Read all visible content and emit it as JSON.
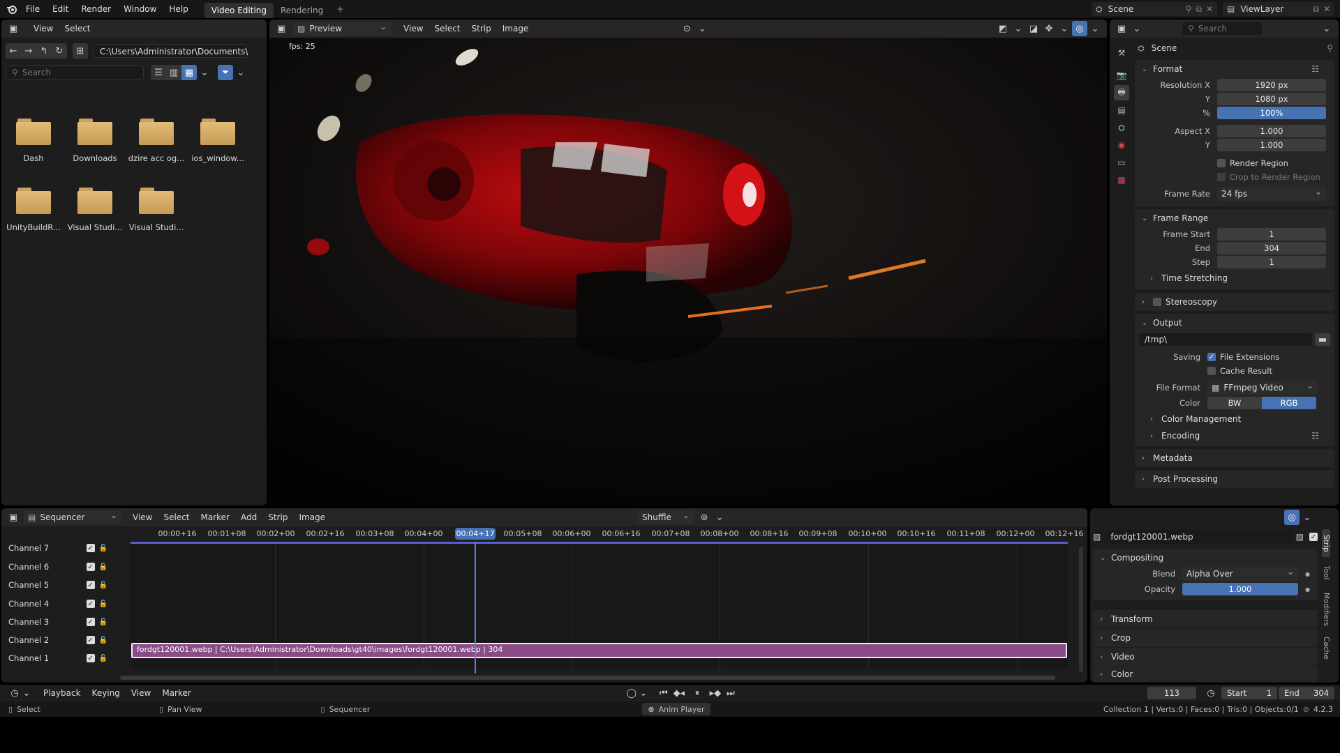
{
  "menu": {
    "items": [
      "File",
      "Edit",
      "Render",
      "Window",
      "Help"
    ],
    "workspaces": [
      "Video Editing",
      "Rendering"
    ],
    "add_tab": "+",
    "scene_name": "Scene",
    "view_layer": "ViewLayer"
  },
  "file_browser": {
    "menu": [
      "View",
      "Select"
    ],
    "path": "C:\\Users\\Administrator\\Documents\\",
    "search_placeholder": "Search",
    "items": [
      "Dash",
      "Downloads",
      "dzire acc og...",
      "ios_window...",
      "UnityBuildR...",
      "Visual Studi...",
      "Visual Studi..."
    ]
  },
  "preview": {
    "mode": "Preview",
    "menu": [
      "View",
      "Select",
      "Strip",
      "Image"
    ],
    "fps_text": "fps: 25"
  },
  "properties": {
    "search_placeholder": "Search",
    "context": "Scene",
    "format": {
      "title": "Format",
      "resolution_x_label": "Resolution X",
      "resolution_x": "1920 px",
      "y_label": "Y",
      "resolution_y": "1080 px",
      "pct_label": "%",
      "resolution_pct": "100%",
      "aspect_x_label": "Aspect X",
      "aspect_x": "1.000",
      "aspect_y_label": "Y",
      "aspect_y": "1.000",
      "render_region": "Render Region",
      "crop_region": "Crop to Render Region",
      "frame_rate_label": "Frame Rate",
      "frame_rate": "24 fps"
    },
    "frame_range": {
      "title": "Frame Range",
      "start_label": "Frame Start",
      "start": "1",
      "end_label": "End",
      "end": "304",
      "step_label": "Step",
      "step": "1",
      "time_stretching": "Time Stretching"
    },
    "stereoscopy": "Stereoscopy",
    "output": {
      "title": "Output",
      "path": "/tmp\\",
      "saving_label": "Saving",
      "file_extensions": "File Extensions",
      "cache_result": "Cache Result",
      "file_format_label": "File Format",
      "file_format": "FFmpeg Video",
      "color_label": "Color",
      "color_bw": "BW",
      "color_rgb": "RGB",
      "color_management": "Color Management",
      "encoding": "Encoding"
    },
    "metadata": "Metadata",
    "post_processing": "Post Processing"
  },
  "sequencer": {
    "editor": "Sequencer",
    "menu": [
      "View",
      "Select",
      "Marker",
      "Add",
      "Strip",
      "Image"
    ],
    "snap_mode": "Shuffle",
    "timecodes": [
      "00:00+16",
      "00:01+08",
      "00:02+00",
      "00:02+16",
      "00:03+08",
      "00:04+00",
      "00:04+17",
      "00:05+08",
      "00:06+00",
      "00:06+16",
      "00:07+08",
      "00:08+00",
      "00:08+16",
      "00:09+08",
      "00:10+00",
      "00:10+16",
      "00:11+08",
      "00:12+00",
      "00:12+16"
    ],
    "current_timecode": "00:04+17",
    "channels": [
      "Channel 7",
      "Channel 6",
      "Channel 5",
      "Channel 4",
      "Channel 3",
      "Channel 2",
      "Channel 1"
    ],
    "strip_label": "fordgt120001.webp | C:\\Users\\Administrator\\Downloads\\gt40\\images\\fordgt120001.webp | 304"
  },
  "strip_props": {
    "name": "fordgt120001.webp",
    "compositing": "Compositing",
    "blend_label": "Blend",
    "blend": "Alpha Over",
    "opacity_label": "Opacity",
    "opacity": "1.000",
    "sections": [
      "Transform",
      "Crop",
      "Video",
      "Color"
    ],
    "tabs": [
      "Strip",
      "Tool",
      "Modifiers",
      "Cache"
    ]
  },
  "timeline_bar": {
    "menu": [
      "Playback",
      "Keying",
      "View",
      "Marker"
    ],
    "current_frame": "113",
    "start_label": "Start",
    "start": "1",
    "end_label": "End",
    "end": "304"
  },
  "status_bar": {
    "select": "Select",
    "pan_view": "Pan View",
    "sequencer": "Sequencer",
    "anim_player": "Anim Player",
    "stats": "Collection 1 | Verts:0 | Faces:0 | Tris:0 | Objects:0/1",
    "version": "4.2.3"
  },
  "colors": {
    "accent": "#4772b3",
    "strip": "#8a4b86",
    "playhead": "#5b7fe0"
  }
}
